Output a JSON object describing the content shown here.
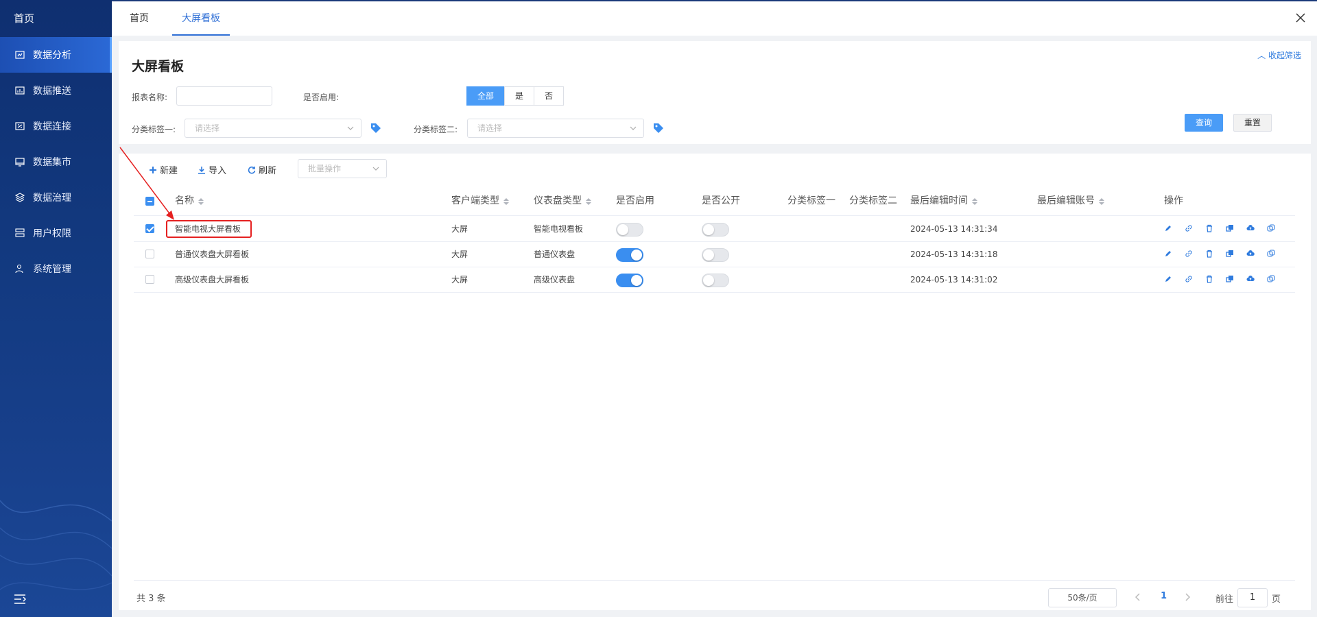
{
  "sidebar": {
    "home": "首页",
    "items": [
      {
        "label": "数据分析",
        "icon": "chart-icon"
      },
      {
        "label": "数据推送",
        "icon": "bar-chart-icon"
      },
      {
        "label": "数据连接",
        "icon": "connection-icon"
      },
      {
        "label": "数据集市",
        "icon": "monitor-icon"
      },
      {
        "label": "数据治理",
        "icon": "layers-icon"
      },
      {
        "label": "用户权限",
        "icon": "user-list-icon"
      },
      {
        "label": "系统管理",
        "icon": "settings-user-icon"
      }
    ]
  },
  "tabs": {
    "home": "首页",
    "current": "大屏看板"
  },
  "filter": {
    "title": "大屏看板",
    "collapse": "收起筛选",
    "name_label": "报表名称:",
    "name_value": "",
    "enabled_label": "是否启用:",
    "enabled_options": [
      "全部",
      "是",
      "否"
    ],
    "tag1_label": "分类标签一:",
    "tag1_placeholder": "请选择",
    "tag2_label": "分类标签二:",
    "tag2_placeholder": "请选择",
    "query": "查询",
    "reset": "重置"
  },
  "toolbar": {
    "new": "新建",
    "import": "导入",
    "refresh": "刷新",
    "batch": "批量操作"
  },
  "table": {
    "headers": {
      "name": "名称",
      "client": "客户端类型",
      "dash": "仪表盘类型",
      "enabled": "是否启用",
      "public": "是否公开",
      "tag1": "分类标签一",
      "tag2": "分类标签二",
      "time": "最后编辑时间",
      "account": "最后编辑账号",
      "ops": "操作"
    },
    "rows": [
      {
        "name": "智能电视大屏看板",
        "client": "大屏",
        "dash": "智能电视看板",
        "enabled": false,
        "public": false,
        "time": "2024-05-13 14:31:34",
        "checked": true
      },
      {
        "name": "普通仪表盘大屏看板",
        "client": "大屏",
        "dash": "普通仪表盘",
        "enabled": true,
        "public": false,
        "time": "2024-05-13 14:31:18",
        "checked": false
      },
      {
        "name": "高级仪表盘大屏看板",
        "client": "大屏",
        "dash": "高级仪表盘",
        "enabled": true,
        "public": false,
        "time": "2024-05-13 14:31:02",
        "checked": false
      }
    ]
  },
  "pagination": {
    "total": "共 3 条",
    "page_size": "50条/页",
    "current": "1",
    "goto_prefix": "前往",
    "goto_value": "1",
    "goto_suffix": "页"
  },
  "colors": {
    "accent": "#3a8ef0",
    "sidebar": "#12397f",
    "highlight": "#e52020"
  }
}
